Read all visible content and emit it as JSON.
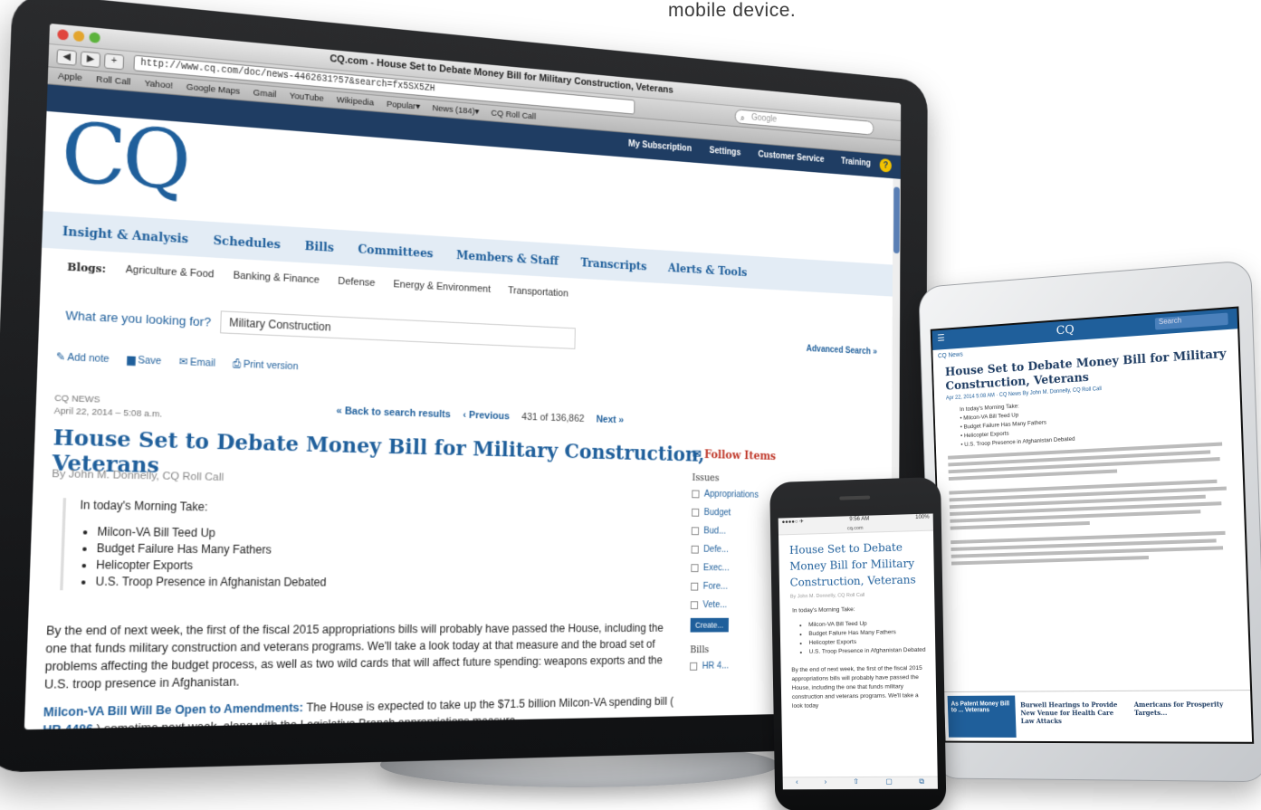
{
  "caption": "mobile device.",
  "browser": {
    "window_title": "CQ.com - House Set to Debate Money Bill for Military Construction, Veterans",
    "url": "http://www.cq.com/doc/news-4462631?57&search=fx5SX5ZH",
    "search_placeholder": "Google",
    "bookmarks": [
      "Apple",
      "Roll Call",
      "Yahoo!",
      "Google Maps",
      "Gmail",
      "YouTube",
      "Wikipedia",
      "Popular▾",
      "News (184)▾",
      "CQ Roll Call"
    ]
  },
  "site": {
    "logo": "CQ",
    "top_links": [
      "My Subscription",
      "Settings",
      "Customer Service",
      "Training"
    ],
    "help_icon_glyph": "?",
    "main_nav": [
      "Insight & Analysis",
      "Schedules",
      "Bills",
      "Committees",
      "Members & Staff",
      "Transcripts",
      "Alerts & Tools"
    ],
    "blogs_label": "Blogs:",
    "blogs": [
      "Agriculture & Food",
      "Banking & Finance",
      "Defense",
      "Energy & Environment",
      "Transportation"
    ],
    "search_prompt": "What are you looking for?",
    "search_value": "Military Construction",
    "advanced_search": "Advanced Search »",
    "actions": [
      "Add note",
      "Save",
      "Email",
      "Print version"
    ],
    "meta_source": "CQ NEWS",
    "meta_date": "April 22, 2014 – 5:08 a.m.",
    "pager": {
      "back": "« Back to search results",
      "previous": "‹ Previous",
      "count": "431 of 136,862",
      "next": "Next »"
    },
    "headline": "House Set to Debate Money Bill for Military Construction, Veterans",
    "byline": "By John M. Donnelly, CQ Roll Call",
    "take_title": "In today's Morning Take:",
    "take_items": [
      "Milcon-VA Bill Teed Up",
      "Budget Failure Has Many Fathers",
      "Helicopter Exports",
      "U.S. Troop Presence in Afghanistan Debated"
    ],
    "body_para": "By the end of next week, the first of the fiscal 2015 appropriations bills will probably have passed the House, including the one that funds military construction and veterans programs. We'll take a look today at that measure and the broad set of problems affecting the budget process, as well as two wild cards that will affect future spending: weapons exports and the U.S. troop presence in Afghanistan.",
    "body_lead": "Milcon-VA Bill Will Be Open to Amendments:",
    "body_lead_text": "The House is expected to take up the $71.5 billion Milcon-VA spending bill (",
    "body_bill": "HR 4486",
    "body_tail": ") sometime next week, along with the Legislative Branch appropriations measure",
    "sidebar": {
      "follow": "Follow Items",
      "issues_label": "Issues",
      "issues": [
        "Appropriations",
        "Budget",
        "Bud...",
        "Defe...",
        "Exec...",
        "Fore...",
        "Vete..."
      ],
      "create": "Create...",
      "bills_label": "Bills",
      "bills": [
        "HR 4..."
      ]
    }
  },
  "tablet": {
    "logo": "CQ",
    "search": "Search",
    "section": "CQ News",
    "headline": "House Set to Debate Money Bill for Military Construction, Veterans",
    "byline": "Apr 22, 2014 5:08 AM  · CQ News  By John M. Donnelly, CQ Roll Call",
    "take_title": "In today's Morning Take:",
    "take_items": [
      "Milcon-VA Bill Teed Up",
      "Budget Failure Has Many Fathers",
      "Helicopter Exports",
      "U.S. Troop Presence in Afghanistan Debated"
    ],
    "promo1": "As Patent Money Bill to ... Veterans",
    "promo2": "Burwell Hearings to Provide New Venue for Health Care Law Attacks",
    "promo3": "Americans for Prosperity Targets..."
  },
  "phone": {
    "carrier": "●●●●○ ✈",
    "time": "9:56 AM",
    "battery": "100%",
    "url": "cq.com",
    "headline": "House Set to Debate Money Bill for Military Construction, Veterans",
    "byline": "By John M. Donnelly, CQ Roll Call",
    "take_title": "In today's Morning Take:",
    "take_items": [
      "Milcon-VA Bill Teed Up",
      "Budget Failure Has Many Fathers",
      "Helicopter Exports",
      "U.S. Troop Presence in Afghanistan Debated"
    ],
    "body": "By the end of next week, the first of the fiscal 2015 appropriations bills will probably have passed the House, including the one that funds military construction and veterans programs. We'll take a look today",
    "toolbar_icons": [
      "‹",
      "›",
      "⇧",
      "▢",
      "⧉"
    ]
  }
}
